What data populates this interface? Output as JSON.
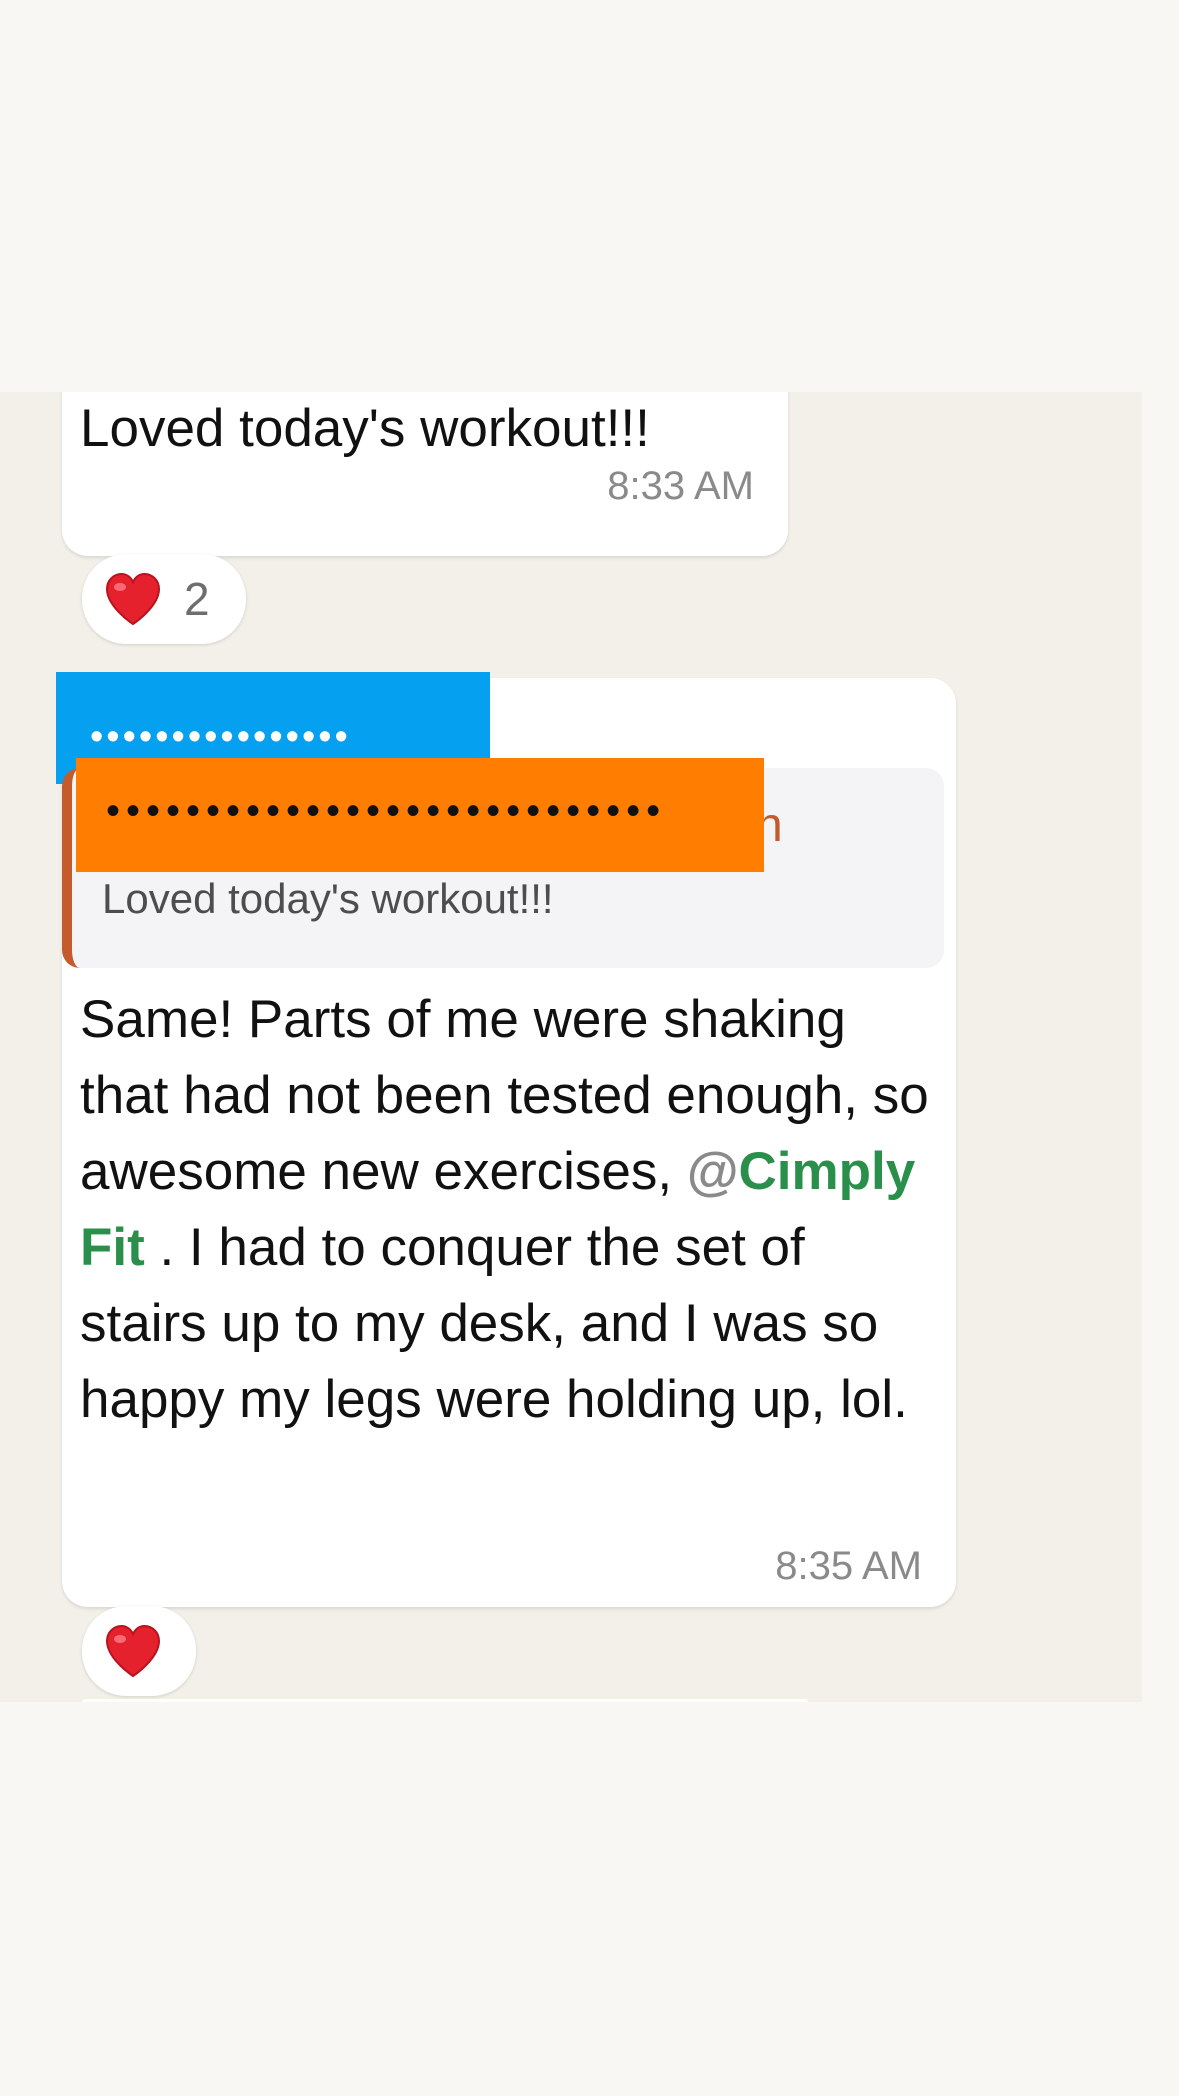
{
  "messages": [
    {
      "text": "Loved today's workout!!!",
      "time": "8:33 AM",
      "reaction": {
        "icon": "heart-icon",
        "emoji": "❤️",
        "count": "2"
      }
    },
    {
      "sender_redacted": "••••••••••••••••",
      "quoted": {
        "author_redacted": "••••••••••••••••••••••••••••",
        "author_tail": "n",
        "text": "Loved today's workout!!!"
      },
      "text_before": "Same! Parts of me were shaking that had not been tested enough, so awesome new exercises, ",
      "mention_at": "@",
      "mention_name": "Cimply Fit",
      "text_after": " . I had to conquer the set of stairs up to my desk, and I was so happy my legs were holding up, lol.",
      "time": "8:35 AM",
      "reaction": {
        "icon": "heart-icon",
        "emoji": "❤️"
      }
    }
  ],
  "colors": {
    "page_bg": "#f8f7f3",
    "chat_bg": "#f2f0e9",
    "bubble_bg": "#ffffff",
    "mention": "#2a8f4a",
    "quote_accent": "#c45b2c",
    "redaction_blue": "#06a0f0",
    "redaction_orange": "#ff7d00",
    "timestamp": "#8a8a8a"
  }
}
